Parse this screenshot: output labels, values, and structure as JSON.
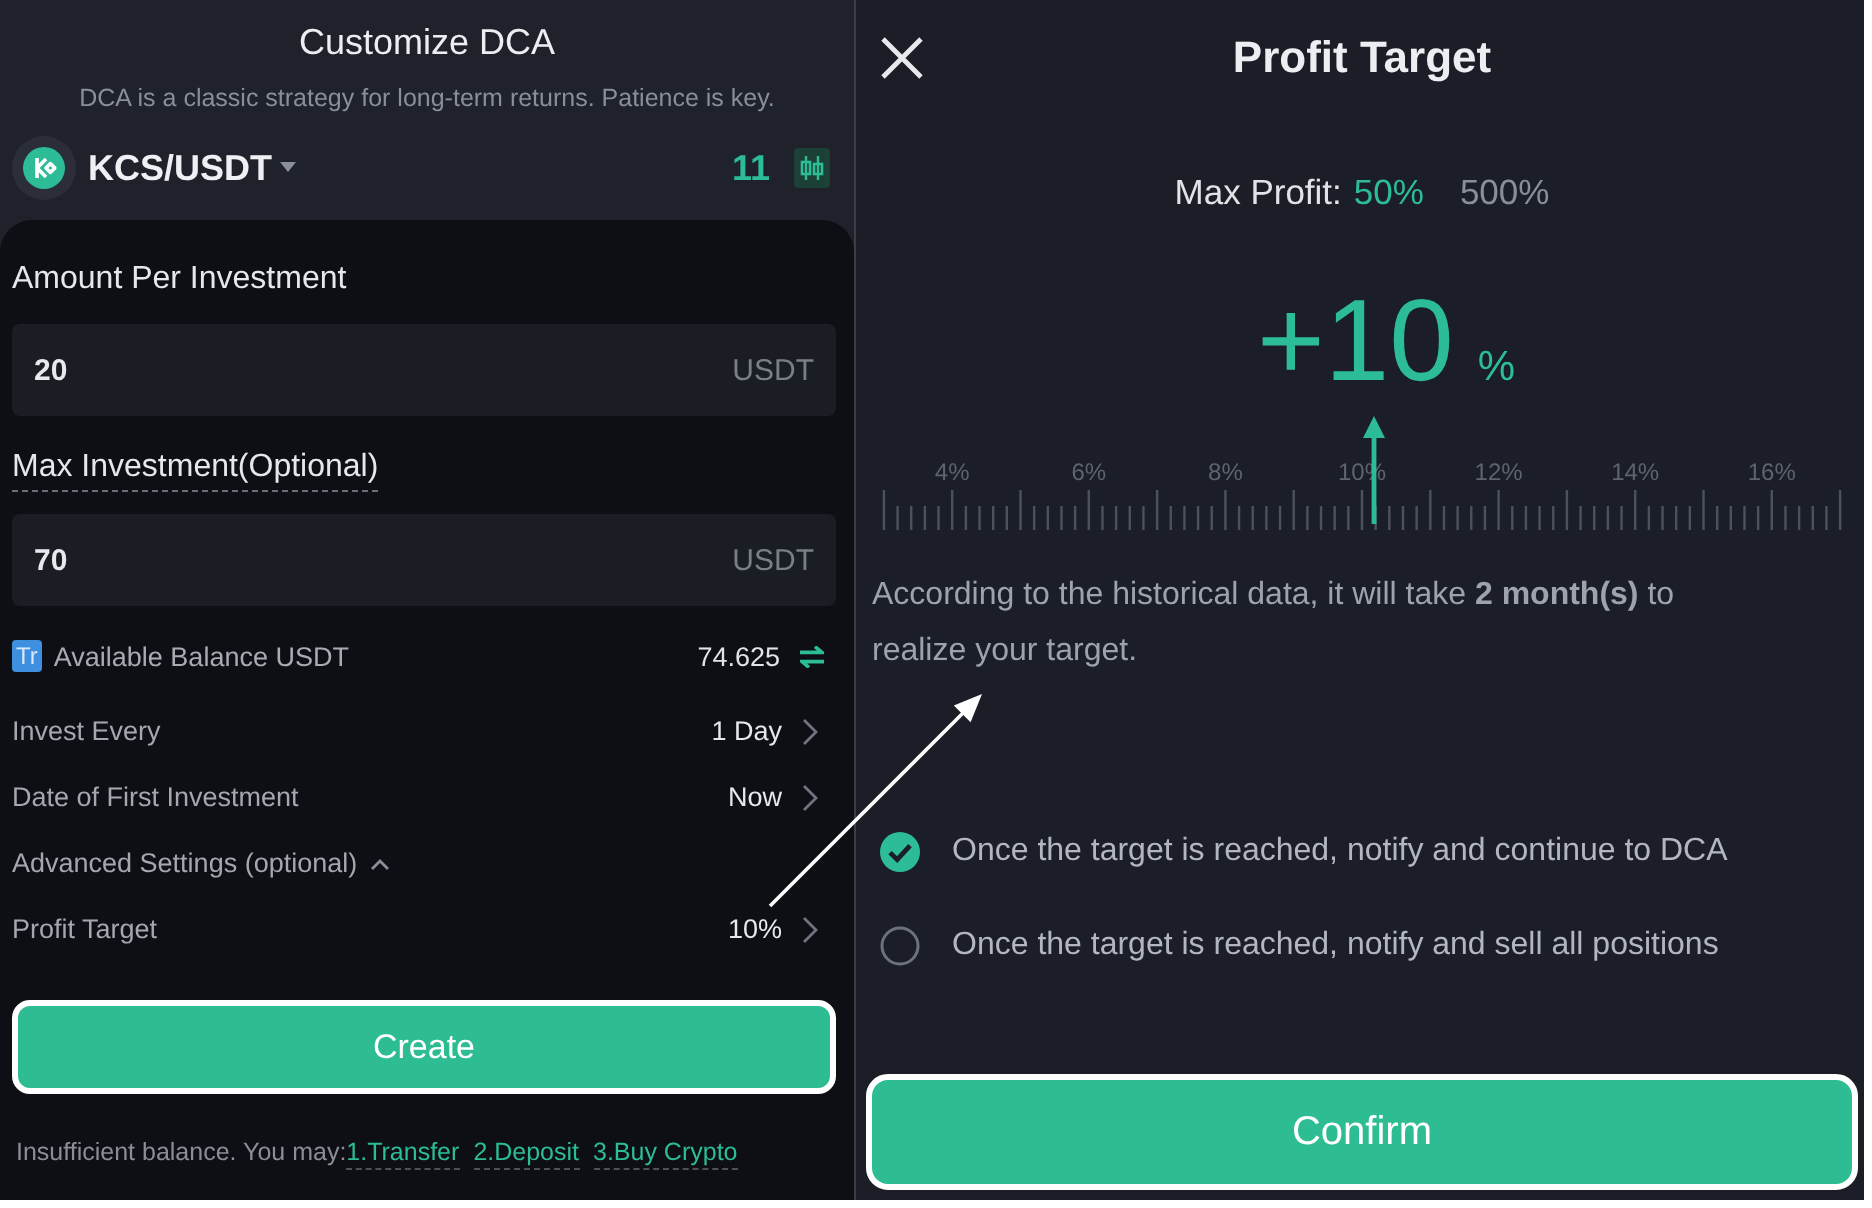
{
  "left": {
    "title": "Customize DCA",
    "subtitle": "DCA is a classic strategy for long-term returns. Patience is key.",
    "pair": {
      "symbol": "KCS/USDT",
      "count": "11"
    },
    "fields": [
      {
        "label": "Amount Per Investment",
        "has_tooltip": false,
        "value": "20",
        "unit": "USDT"
      },
      {
        "label": "Max Investment(Optional)",
        "has_tooltip": true,
        "value": "70",
        "unit": "USDT"
      }
    ],
    "balance": {
      "badge": "Tr",
      "label": "Available Balance USDT",
      "value": "74.625"
    },
    "rows": [
      {
        "label": "Invest Every",
        "value": "1 Day"
      },
      {
        "label": "Date of First Investment",
        "value": "Now"
      }
    ],
    "advanced": {
      "label": "Advanced Settings (optional)",
      "expanded": true,
      "rows": [
        {
          "label": "Profit Target",
          "value": "10%"
        }
      ]
    },
    "create_button": "Create",
    "notice": {
      "text": "Insufficient balance. You may:",
      "links": [
        "1.Transfer",
        "2.Deposit",
        "3.Buy Crypto"
      ]
    }
  },
  "right": {
    "title": "Profit Target",
    "max_profit": {
      "label": "Max Profit:",
      "options": [
        {
          "label": "50%",
          "selected": true
        },
        {
          "label": "500%",
          "selected": false
        }
      ]
    },
    "target": {
      "value": "+10",
      "unit": "%"
    },
    "ruler": {
      "labels": [
        "4%",
        "6%",
        "8%",
        "10%",
        "12%",
        "14%",
        "16%"
      ]
    },
    "estimate": "According to the historical data, it will take **2 month(s)** to realize your target.",
    "options": [
      {
        "label": "Once the target is reached, notify and continue to DCA",
        "selected": true
      },
      {
        "label": "Once the target is reached, notify and sell all positions",
        "selected": false
      }
    ],
    "confirm_button": "Confirm"
  }
}
